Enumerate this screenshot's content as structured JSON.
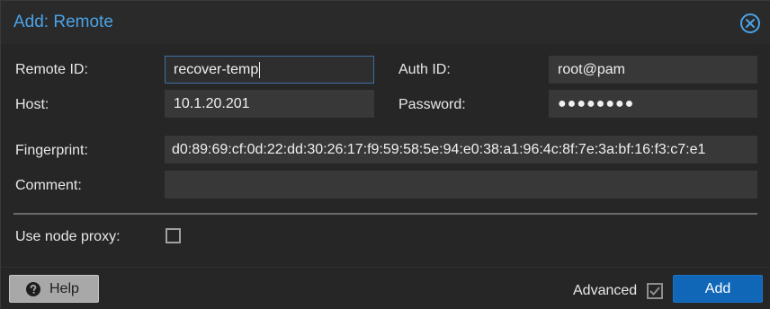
{
  "dialog": {
    "title": "Add: Remote"
  },
  "form": {
    "remote_id": {
      "label": "Remote ID:",
      "value": "recover-temp"
    },
    "host": {
      "label": "Host:",
      "value": "10.1.20.201"
    },
    "auth_id": {
      "label": "Auth ID:",
      "value": "root@pam"
    },
    "password": {
      "label": "Password:",
      "value": "●●●●●●●●"
    },
    "fingerprint": {
      "label": "Fingerprint:",
      "value": "d0:89:69:cf:0d:22:dd:30:26:17:f9:59:58:5e:94:e0:38:a1:96:4c:8f:7e:3a:bf:16:f3:c7:e1"
    },
    "comment": {
      "label": "Comment:",
      "value": ""
    },
    "use_node_proxy": {
      "label": "Use node proxy:",
      "checked": false
    }
  },
  "footer": {
    "help_label": "Help",
    "advanced_label": "Advanced",
    "advanced_checked": true,
    "add_label": "Add"
  },
  "colors": {
    "accent": "#4ba3e8",
    "primary_button": "#1067b8",
    "background": "#262626",
    "field": "#383838"
  },
  "icons": {
    "close": "close-circle-icon",
    "help": "question-circle-icon",
    "advanced_check": "checkmark-icon"
  }
}
